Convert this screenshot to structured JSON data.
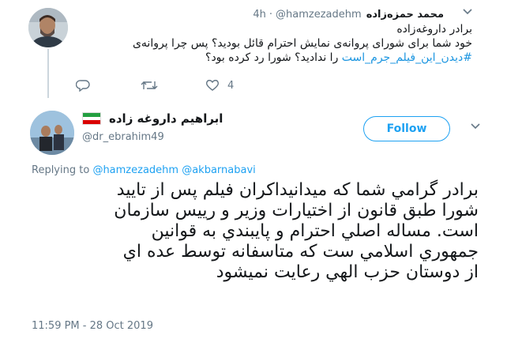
{
  "parent_tweet": {
    "author_name": "محمد حمزه‌زاده",
    "handle": "@hamzezadehm",
    "separator": "·",
    "time": "4h",
    "lines": [
      "برادر داروغه‌زاده",
      "خود شما برای شورای پروانه‌ی نمایش احترام قائل بودید؟ پس چرا پروانه‌ی"
    ],
    "line3_hashtag": "#دیدن_این_فیلم_جرم_است",
    "line3_rest": " را ندادید؟ شورا رد کرده بود؟",
    "reply_icon": "reply-icon",
    "retweet_icon": "retweet-icon",
    "like_icon": "heart-icon",
    "like_count": "4"
  },
  "main_tweet": {
    "author_name": "ابراهيم داروغه زاده",
    "handle": "@dr_ebrahim49",
    "follow_label": "Follow",
    "replying_prefix": "Replying to ",
    "replying_mentions": [
      "@hamzezadehm",
      "@akbarnabavi"
    ],
    "lines": [
      "برادر گرامي شما كه ميدانيداكران فيلم پس از تاييد",
      "شورا طبق قانون از اختيارات وزير و رييس سازمان",
      "است. مساله اصلي احترام و پايبندي به قوانين",
      "جمهوري اسلامي ست كه متاسفانه توسط عده اي",
      "از دوستان حزب الهي رعايت نميشود"
    ],
    "timestamp": "11:59 PM - 28 Oct 2019"
  },
  "colors": {
    "accent": "#1da1f2",
    "hashtag": "#1b95e0",
    "muted": "#657786",
    "flag_green": "#239f40",
    "flag_white": "#ffffff",
    "flag_red": "#da0000"
  }
}
